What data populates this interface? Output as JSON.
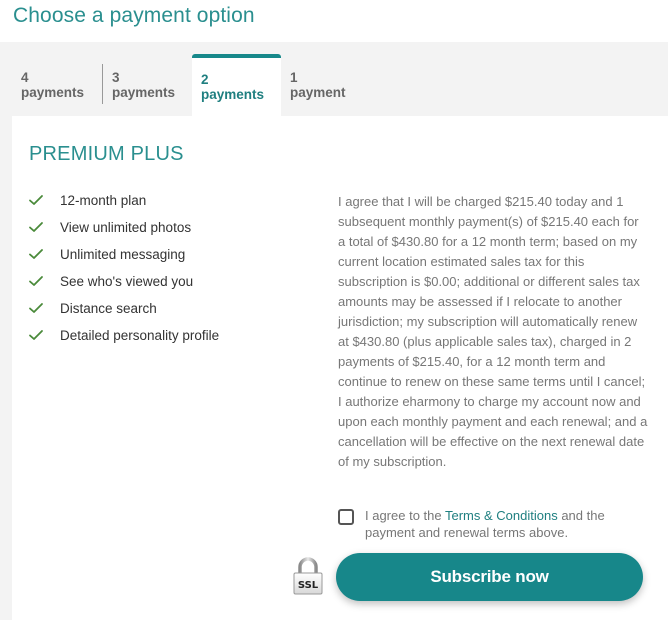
{
  "page": {
    "title": "Choose a payment option"
  },
  "colors": {
    "accent": "#17878a",
    "check": "#4a8a3a",
    "text_muted": "#777777",
    "band": "#f3f3f3"
  },
  "tabs": [
    {
      "label": "4 payments",
      "active": false
    },
    {
      "label": "3 payments",
      "active": false
    },
    {
      "label": "2 payments",
      "active": true
    },
    {
      "label": "1 payment",
      "active": false
    }
  ],
  "plan": {
    "title": "PREMIUM PLUS",
    "features": [
      {
        "icon": "check-icon",
        "label": "12-month plan"
      },
      {
        "icon": "check-icon",
        "label": "View unlimited photos"
      },
      {
        "icon": "check-icon",
        "label": "Unlimited messaging"
      },
      {
        "icon": "check-icon",
        "label": "See who's viewed you"
      },
      {
        "icon": "check-icon",
        "label": "Distance search"
      },
      {
        "icon": "check-icon",
        "label": "Detailed personality profile"
      }
    ]
  },
  "terms": {
    "text": "I agree that I will be charged $215.40 today and 1 subsequent monthly payment(s) of $215.40 each for a total of $430.80 for a 12 month term; based on my current location estimated sales tax for this subscription is $0.00; additional or different sales tax amounts may be assessed if I relocate to another jurisdiction; my subscription will automatically renew at $430.80 (plus applicable sales tax), charged in 2 payments of $215.40, for a 12 month term and continue to renew on these same terms until I cancel; I authorize eharmony to charge my account now and upon each monthly payment and each renewal; and a cancellation will be effective on the next renewal date of my subscription."
  },
  "agreement": {
    "checked": false,
    "prefix": "I agree to the ",
    "link_label": "Terms & Conditions",
    "suffix": " and the payment and renewal terms above."
  },
  "ssl": {
    "icon": "ssl-lock-icon",
    "label": "SSL"
  },
  "subscribe": {
    "label": "Subscribe now"
  }
}
